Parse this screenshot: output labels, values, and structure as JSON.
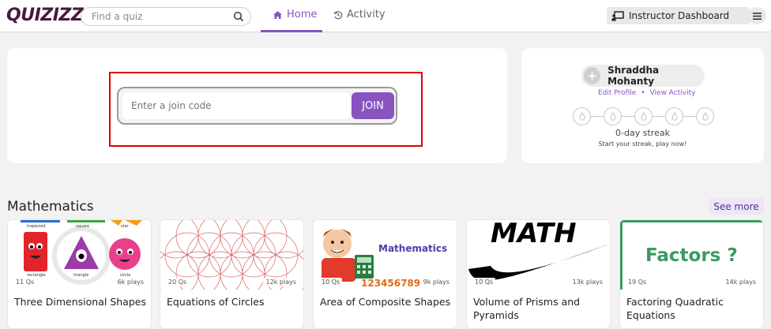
{
  "header": {
    "logo": "QUIZIZZ",
    "search_placeholder": "Find a quiz",
    "nav_home": "Home",
    "nav_activity": "Activity",
    "instructor_dashboard": "Instructor Dashboard"
  },
  "join": {
    "placeholder": "Enter a join code",
    "button": "JOIN"
  },
  "profile": {
    "name": "Shraddha Mohanty",
    "edit_profile": "Edit Profile",
    "separator": "•",
    "view_activity": "View Activity",
    "streak_label": "0-day streak",
    "streak_sub": "Start your streak, play now!"
  },
  "section": {
    "title": "Mathematics",
    "see_more": "See more"
  },
  "quizzes": [
    {
      "title": "Three Dimensional Shapes",
      "qs": "11 Qs",
      "plays": "6k plays",
      "thumb_labels": [
        "trapezoid",
        "square",
        "star",
        "rectangle",
        "triangle",
        "circle"
      ]
    },
    {
      "title": "Equations of Circles",
      "qs": "20 Qs",
      "plays": "12k plays"
    },
    {
      "title": "Area of Composite Shapes",
      "qs": "10 Qs",
      "plays": "9k plays",
      "thumb_text": "Mathematics",
      "thumb_numbers": "123456789"
    },
    {
      "title": "Volume of Prisms and Pyramids",
      "qs": "10 Qs",
      "plays": "13k plays",
      "thumb_text": "MATH"
    },
    {
      "title": "Factoring Quadratic Equations",
      "qs": "19 Qs",
      "plays": "14k plays",
      "thumb_text": "Factors ?"
    }
  ],
  "colors": {
    "brand": "#8854c0",
    "highlight": "#e00000",
    "chalkboard": "#3a9b62"
  }
}
